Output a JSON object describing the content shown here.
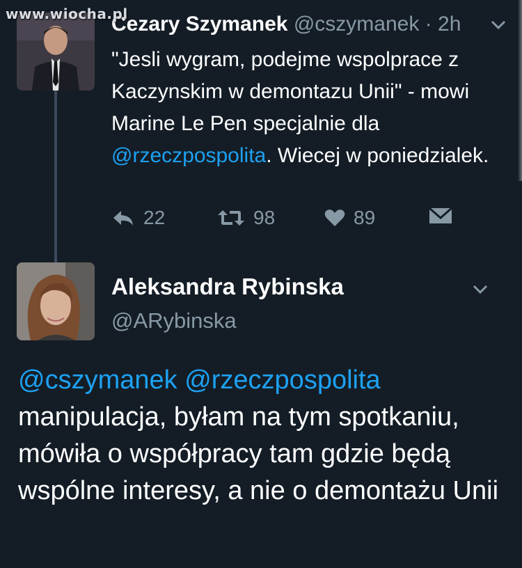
{
  "watermark": "www.wiocha.pl",
  "tweet1": {
    "name": "Cezary Szymanek",
    "handle": "@cszymanek",
    "separator": "·",
    "time": "2h",
    "text_before": "\"Jesli wygram, podejme wspolprace z Kaczynskim w demontazu Unii\" - mowi Marine Le Pen specjalnie dla ",
    "mention": "@rzeczpospolita",
    "text_after": ". Wiecej w poniedzialek.",
    "replies": "22",
    "retweets": "98",
    "likes": "89"
  },
  "tweet2": {
    "name": "Aleksandra Rybinska",
    "handle": "@ARybinska",
    "mentions": "@cszymanek @rzeczpospolita",
    "text": "manipulacja, byłam na tym spotkaniu, mówiła o współpracy tam gdzie będą wspólne interesy, a nie o demontażu Unii"
  },
  "icons": {
    "reply": "reply-icon",
    "retweet": "retweet-icon",
    "like": "heart-icon",
    "dm": "envelope-icon",
    "more": "chevron-down-icon"
  },
  "colors": {
    "background": "#141d26",
    "link": "#1da1f2",
    "muted": "#8899a6"
  }
}
